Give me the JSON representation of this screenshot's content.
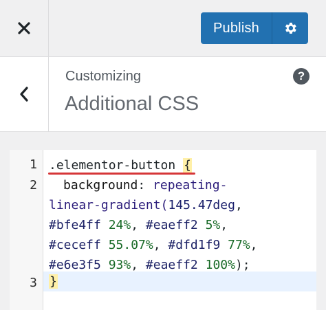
{
  "topbar": {
    "close_icon": "close-icon",
    "publish_label": "Publish",
    "settings_icon": "gear-icon"
  },
  "header": {
    "breadcrumb": "Customizing",
    "title": "Additional CSS",
    "help_label": "?"
  },
  "editor": {
    "line_numbers": [
      "1",
      "2",
      "3"
    ],
    "lines": {
      "l1_selector": ".elementor-button",
      "l1_brace": "{",
      "l2_property": "background",
      "l2_colon": ": ",
      "l2_value": "repeating-",
      "l3_func": "linear-gradient(",
      "l3_angle": "145.47deg",
      "l3_comma": ",",
      "l4_hex1": "#bfe4ff",
      "l4_pct1": "24%",
      "l4_hex2": "#eaeff2",
      "l4_pct2": "5%",
      "l5_hex3": "#ceceff",
      "l5_pct3": "55.07%",
      "l5_hex4": "#dfd1f9",
      "l5_pct4": "77%",
      "l6_hex5": "#e6e3f5",
      "l6_pct5": "93%",
      "l6_hex6": "#eaeff2",
      "l6_pct6": "100%",
      "l6_end": ");",
      "l7_brace": "}"
    }
  },
  "colors": {
    "accent": "#2271b1",
    "highlight": "#d63638"
  }
}
